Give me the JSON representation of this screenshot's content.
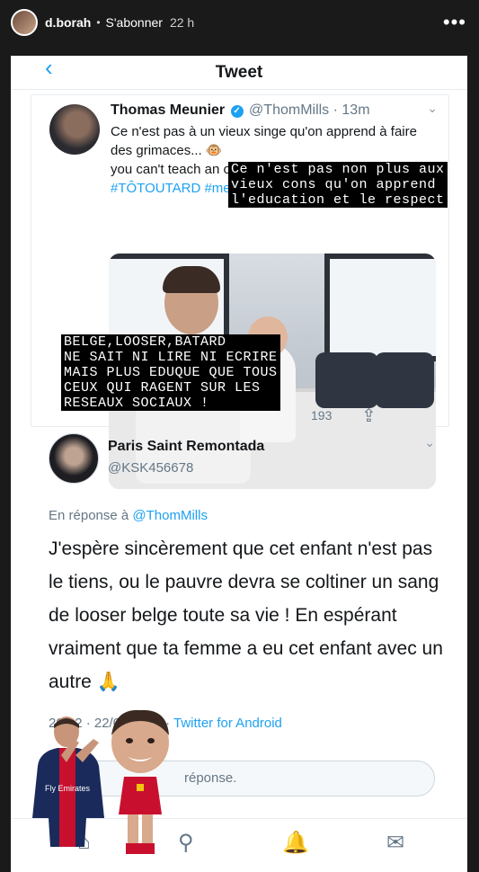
{
  "story": {
    "username": "d.borah",
    "separator": "•",
    "follow_label": "S'abonner",
    "time": "22 h",
    "more_icon": "more-dots-icon"
  },
  "screen": {
    "back_icon": "back-arrow-icon",
    "title": "Tweet"
  },
  "tweet": {
    "author": "Thomas Meunier",
    "verified_icon": "verified-badge-icon",
    "verified_glyph": "✓",
    "handle": "@ThomMills · 13m",
    "line1": "Ce n'est pas à un vieux singe qu'on apprend à faire des grimaces... 🐵",
    "line2": "you can't teach an old dog new tricks 🐶",
    "hashtags": "#TÔTOUTARD #me",
    "chevron": "⌄",
    "count": "193",
    "share_glyph": "⇪"
  },
  "reply": {
    "author": "Paris Saint Remontada",
    "handle": "@KSK456678",
    "chevron": "⌄",
    "in_reply_prefix": "En réponse à",
    "in_reply_handle": "@ThomMills",
    "text": "J'espère sincèrement que cet enfant n'est pas le tiens, ou le pauvre devra se coltiner un sang de looser belge toute sa vie ! En espérant vraiment que ta femme a eu cet enfant avec un autre 🙏",
    "meta_date": "20/02 · 22/09/2019 · ",
    "meta_source": "Twitter for Android"
  },
  "reply_box": {
    "placeholder": "réponse."
  },
  "nav": {
    "items": [
      "home-icon",
      "search-icon",
      "notifications-icon",
      "messages-icon"
    ],
    "glyphs": [
      "⌂",
      "⚲",
      "🔔",
      "✉"
    ]
  },
  "overlays": {
    "right": "Ce n'est pas non plus aux\nvieux cons qu'on apprend\nl'education et le respect",
    "left": "BELGE,LOOSER,BATARD\nNE SAIT NI LIRE NI ECRIRE\nMAIS PLUS EDUQUE QUE TOUS\nCEUX QUI RAGENT SUR LES\nRESEAUX SOCIAUX !"
  },
  "stickers": {
    "psg_player": "psg-player-sticker",
    "psg_jersey_text": "Fly Emirates",
    "belgium_player": "belgium-player-sticker"
  },
  "colors": {
    "twitter_blue": "#1da1f2",
    "text_dark": "#14171a",
    "text_grey": "#657786"
  }
}
